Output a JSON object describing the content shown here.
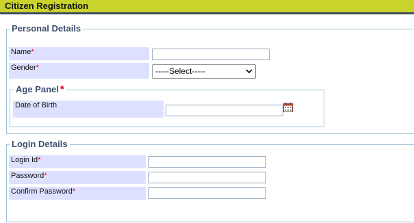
{
  "header": {
    "title": "Citizen Registration"
  },
  "personal": {
    "legend": "Personal Details",
    "name_label": "Name",
    "gender_label": "Gender",
    "gender_selected": "-----Select-----",
    "required_mark": "*"
  },
  "age_panel": {
    "legend": "Age Panel",
    "required_mark": "*",
    "dob_label": "Date of Birth"
  },
  "login": {
    "legend": "Login Details",
    "login_id_label": "Login Id",
    "password_label": "Password",
    "confirm_password_label": "Confirm Password",
    "required_mark": "*"
  },
  "colors": {
    "header_bg": "#c8d42c",
    "header_border": "#3e4a5e",
    "label_bg": "#dde1ff",
    "fieldset_border": "#9cc3d6",
    "legend_text": "#3c4e6e",
    "required": "#e0001a"
  }
}
